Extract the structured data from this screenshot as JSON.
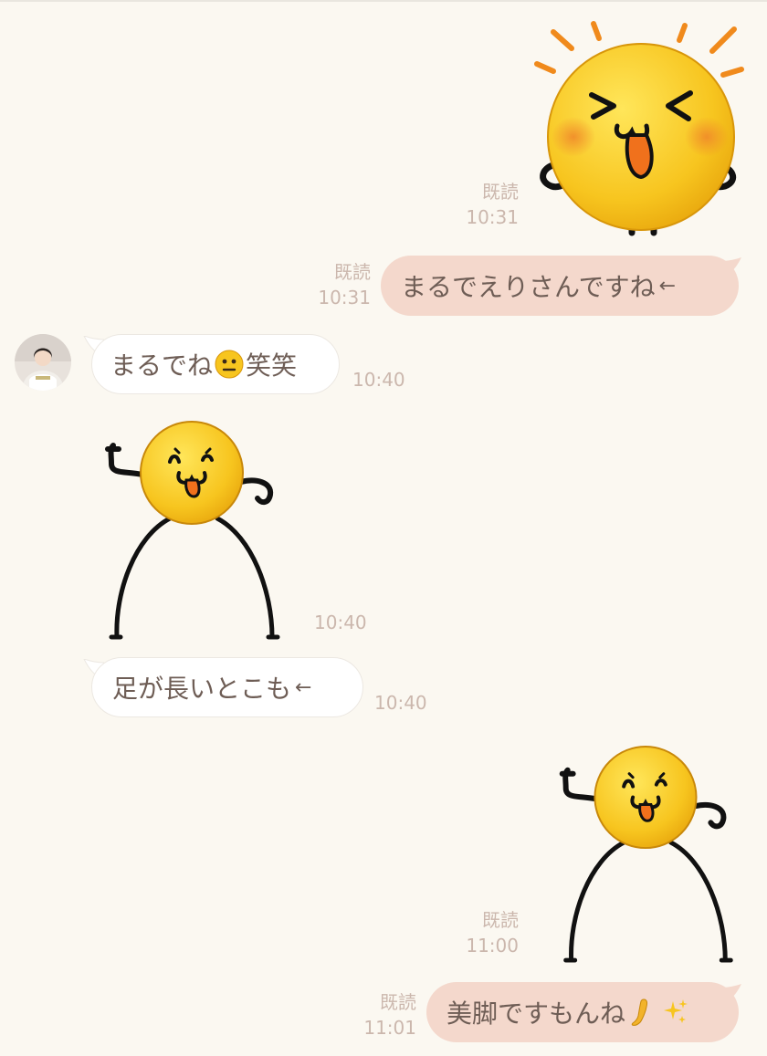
{
  "messages": [
    {
      "id": "m1",
      "type": "sticker",
      "direction": "sent",
      "sticker": "excited-blob-sticker",
      "read_label": "既読",
      "time": "10:31"
    },
    {
      "id": "m2",
      "type": "text",
      "direction": "sent",
      "text": "まるでえりさんですね",
      "suffix": "←",
      "read_label": "既読",
      "time": "10:31"
    },
    {
      "id": "m3",
      "type": "text",
      "direction": "received",
      "text_before": "まるでね",
      "emoji": "neutral-face-emoji",
      "text_after": "笑笑",
      "time": "10:40"
    },
    {
      "id": "m4",
      "type": "sticker",
      "direction": "received",
      "sticker": "long-legs-blob-sticker",
      "time": "10:40"
    },
    {
      "id": "m5",
      "type": "text",
      "direction": "received",
      "text": "足が長いとこも",
      "suffix": "←",
      "time": "10:40"
    },
    {
      "id": "m6",
      "type": "sticker",
      "direction": "sent",
      "sticker": "long-legs-blob-sticker",
      "read_label": "既読",
      "time": "11:00"
    },
    {
      "id": "m7",
      "type": "text",
      "direction": "sent",
      "text": "美脚ですもんね",
      "emoji": "leg-emoji sparkles-emoji",
      "read_label": "既読",
      "time": "11:01"
    }
  ],
  "colors": {
    "background": "#fbf8f1",
    "sent_bubble": "#f4d8cc",
    "received_bubble": "#ffffff",
    "meta_text": "#cbb7ad",
    "message_text": "#6e5d55",
    "sticker_yellow": "#f7c51f"
  }
}
